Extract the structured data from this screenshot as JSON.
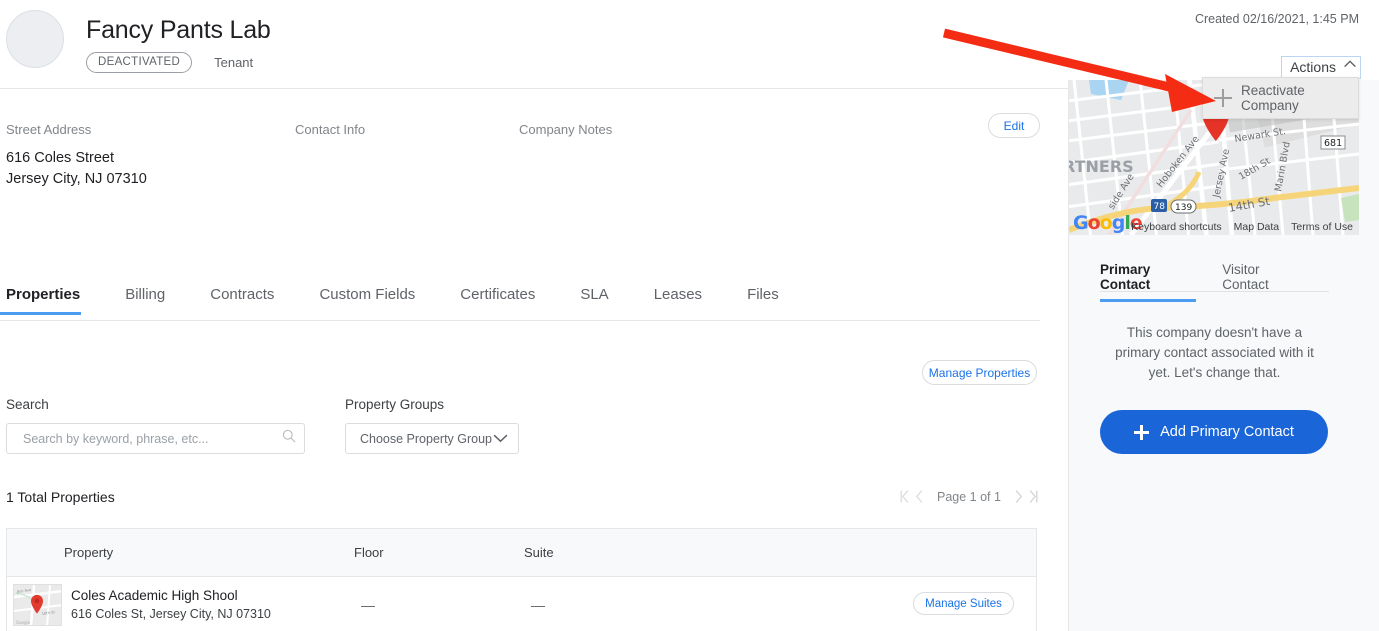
{
  "header": {
    "company_name": "Fancy Pants Lab",
    "status_badge": "DEACTIVATED",
    "type_label": "Tenant",
    "created_label": "Created 02/16/2021, 1:45 PM",
    "actions_button": "Actions"
  },
  "actions_menu": {
    "items": [
      {
        "label": "Reactivate Company",
        "icon": "plus-icon"
      }
    ]
  },
  "info": {
    "street_address_label": "Street Address",
    "contact_info_label": "Contact Info",
    "company_notes_label": "Company Notes",
    "street_address_value": "616 Coles Street\nJersey City, NJ 07310",
    "contact_info_value": "",
    "company_notes_value": "",
    "edit_button": "Edit"
  },
  "tabs": [
    {
      "label": "Properties",
      "active": true
    },
    {
      "label": "Billing",
      "active": false
    },
    {
      "label": "Contracts",
      "active": false
    },
    {
      "label": "Custom Fields",
      "active": false
    },
    {
      "label": "Certificates",
      "active": false
    },
    {
      "label": "SLA",
      "active": false
    },
    {
      "label": "Leases",
      "active": false
    },
    {
      "label": "Files",
      "active": false
    }
  ],
  "properties_panel": {
    "manage_properties_button": "Manage Properties",
    "search_label": "Search",
    "search_placeholder": "Search by keyword, phrase, etc...",
    "search_value": "",
    "property_groups_label": "Property Groups",
    "property_groups_value": "Choose Property Group",
    "total_text": "1 Total Properties",
    "pagination_text": "Page 1 of 1",
    "table": {
      "columns": [
        "Property",
        "Floor",
        "Suite",
        ""
      ],
      "rows": [
        {
          "property_name": "Coles Academic High Shool",
          "property_address": "616 Coles St, Jersey City, NJ 07310",
          "floor": "—",
          "suite": "—",
          "action_button": "Manage Suites"
        }
      ]
    }
  },
  "sidebar": {
    "map": {
      "attribution_google": "Google",
      "keyboard_shortcuts": "Keyboard shortcuts",
      "map_data": "Map Data",
      "terms_of_use": "Terms of Use",
      "street_labels": [
        "Newark St.",
        "Hoboken Ave",
        "Jersey Ave",
        "18th St",
        "Marin Blvd",
        "14th St",
        "side Ave",
        "RTNERS"
      ],
      "route_shields": [
        "681",
        "78",
        "139"
      ]
    },
    "contact_tabs": [
      {
        "label": "Primary Contact",
        "active": true
      },
      {
        "label": "Visitor Contact",
        "active": false
      }
    ],
    "empty_message": "This company doesn't have a primary contact associated with it yet. Let's change that.",
    "add_primary_contact_button": "Add Primary Contact"
  },
  "annotation": {
    "arrow_color": "#f42c13"
  },
  "colors": {
    "accent_blue": "#1a73e8",
    "primary_button": "#1a65d8",
    "tab_underline": "#4a9df0",
    "text_primary": "#202124",
    "text_secondary": "#5f6368",
    "sidebar_bg": "#f8f9fa",
    "border": "#e4e6e8"
  }
}
